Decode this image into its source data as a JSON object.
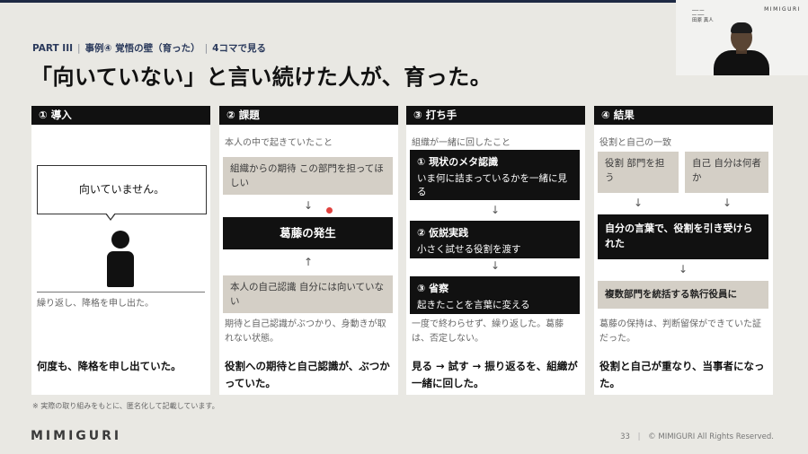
{
  "header": {
    "part": "PART III",
    "case": "事例④ 覚悟の壁（育った）",
    "view": "4コマで見る",
    "title": "「向いていない」と言い続けた人が、育った。"
  },
  "video": {
    "brand": "MIMIGURI",
    "name": "田原 真人"
  },
  "cards": [
    {
      "heading": "① 導入",
      "speech": "向いていません。",
      "note": "繰り返し、降格を申し出た。",
      "summary": "何度も、降格を申し出ていた。"
    },
    {
      "heading": "② 課題",
      "sub": "本人の中で起きていたこと",
      "box_top": "組織からの期待 この部門を担ってほしい",
      "center": "葛藤の発生",
      "box_bottom": "本人の自己認識 自分には向いていない",
      "note": "期待と自己認識がぶつかり、身動きが取れない状態。",
      "summary": "役割への期待と自己認識が、ぶつかっていた。",
      "arrow_down": "↓",
      "arrow_up": "↑"
    },
    {
      "heading": "③ 打ち手",
      "sub": "組織が一緒に回したこと",
      "steps": [
        {
          "title": "① 現状のメタ認識",
          "desc": "いま何に詰まっているかを一緒に見る"
        },
        {
          "title": "② 仮説実践",
          "desc": "小さく試せる役割を渡す"
        },
        {
          "title": "③ 省察",
          "desc": "起きたことを言葉に変える"
        }
      ],
      "arrow": "↓",
      "note": "一度で終わらせず、繰り返した。葛藤は、否定しない。",
      "summary": "見る → 試す → 振り返るを、組織が一緒に回した。"
    },
    {
      "heading": "④ 結果",
      "sub": "役割と自己の一致",
      "box_left": "役割 部門を担う",
      "box_right": "自己 自分は何者か",
      "merged": "自分の言葉で、役割を引き受けられた",
      "final": "複数部門を統括する執行役員に",
      "arrow": "↓",
      "note": "葛藤の保持は、判断留保ができていた証だった。",
      "summary": "役割と自己が重なり、当事者になった。"
    }
  ],
  "footer": {
    "footnote": "※ 実際の取り組みをもとに、匿名化して記載しています。",
    "logo": "MIMIGURI",
    "page": "33",
    "copyright": "© MIMIGURI All Rights Reserved."
  }
}
